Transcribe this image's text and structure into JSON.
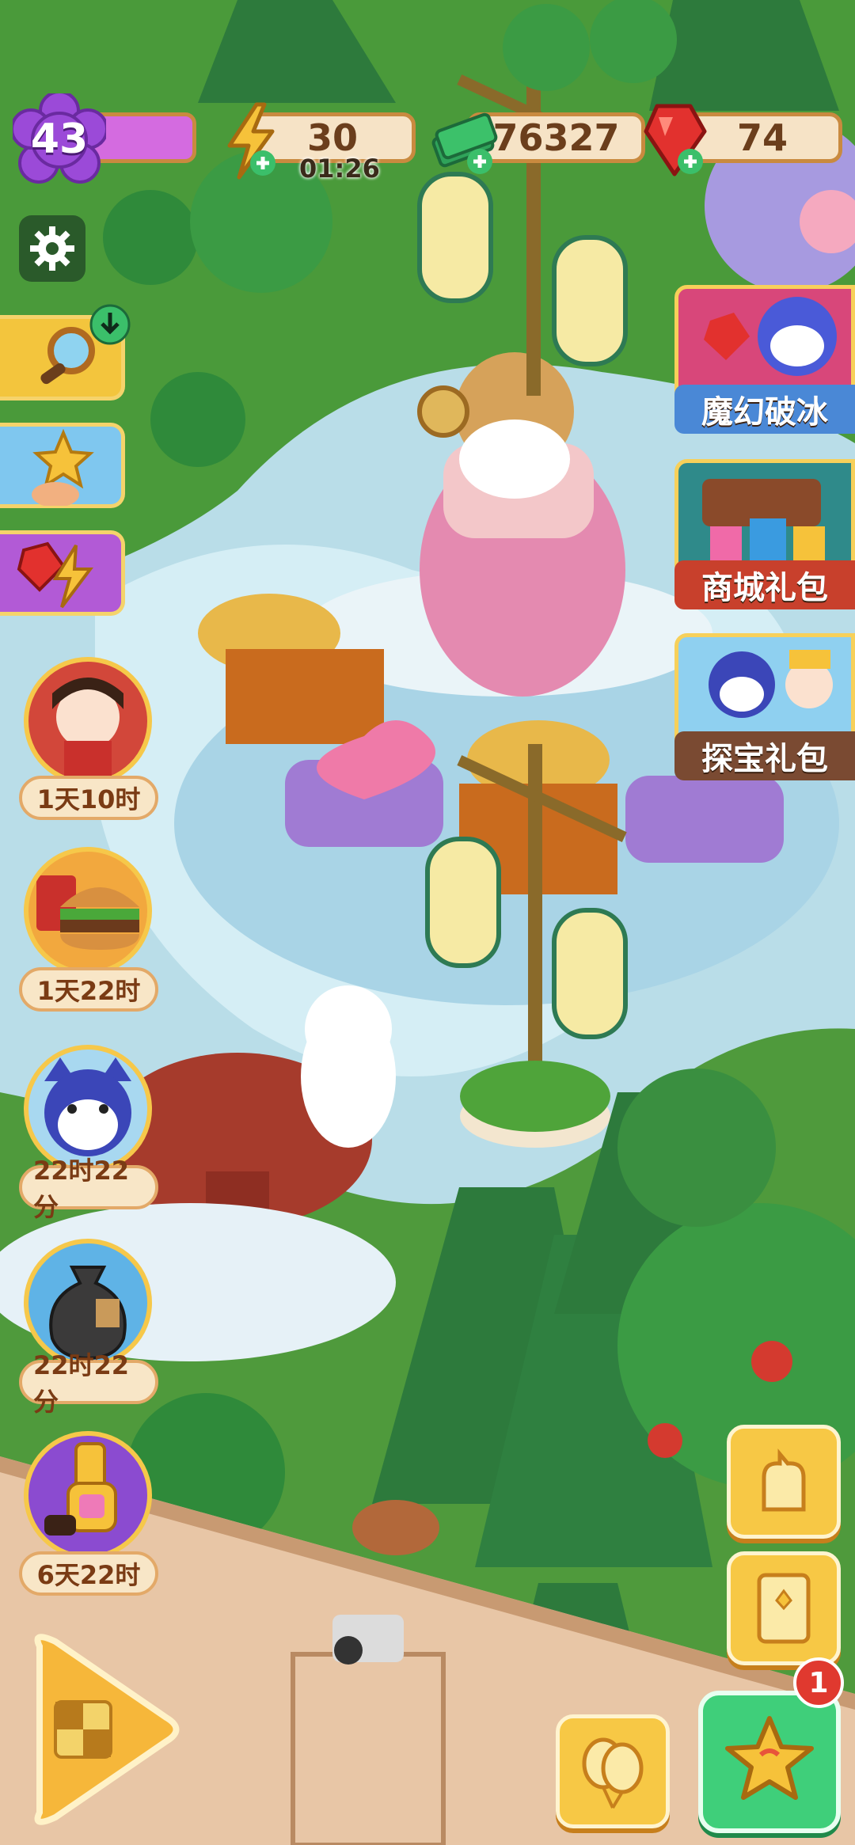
{
  "hud": {
    "level": "43",
    "energy": "30",
    "energy_timer": "01:26",
    "cash": "76327",
    "gems": "74"
  },
  "gift_packs": [
    {
      "label": "魔幻破冰"
    },
    {
      "label": "商城礼包"
    },
    {
      "label": "探宝礼包"
    }
  ],
  "offers": [
    {
      "time": "1天10时"
    },
    {
      "time": "1天22时"
    },
    {
      "time": "22时22分"
    },
    {
      "time": "22时22分"
    },
    {
      "time": "6天22时"
    }
  ],
  "notification_badge": "1",
  "icons": [
    "settings-gear-icon",
    "energy-bolt-icon",
    "cash-stack-icon",
    "red-gem-icon",
    "magnifier-icon",
    "star-icon",
    "gem-lightning-icon",
    "balloon-icon",
    "book-icon",
    "character-icon",
    "star-favorite-icon",
    "arrow-play-icon"
  ],
  "colors": {
    "level_bar": "#d46be0",
    "pill_border": "#c98a3f",
    "gift_label_blue": "#4a88d6",
    "gift_label_red": "#c8402c",
    "gift_label_brown": "#7a4a32",
    "star_button": "#3fcf7a",
    "badge_red": "#e0392f"
  }
}
